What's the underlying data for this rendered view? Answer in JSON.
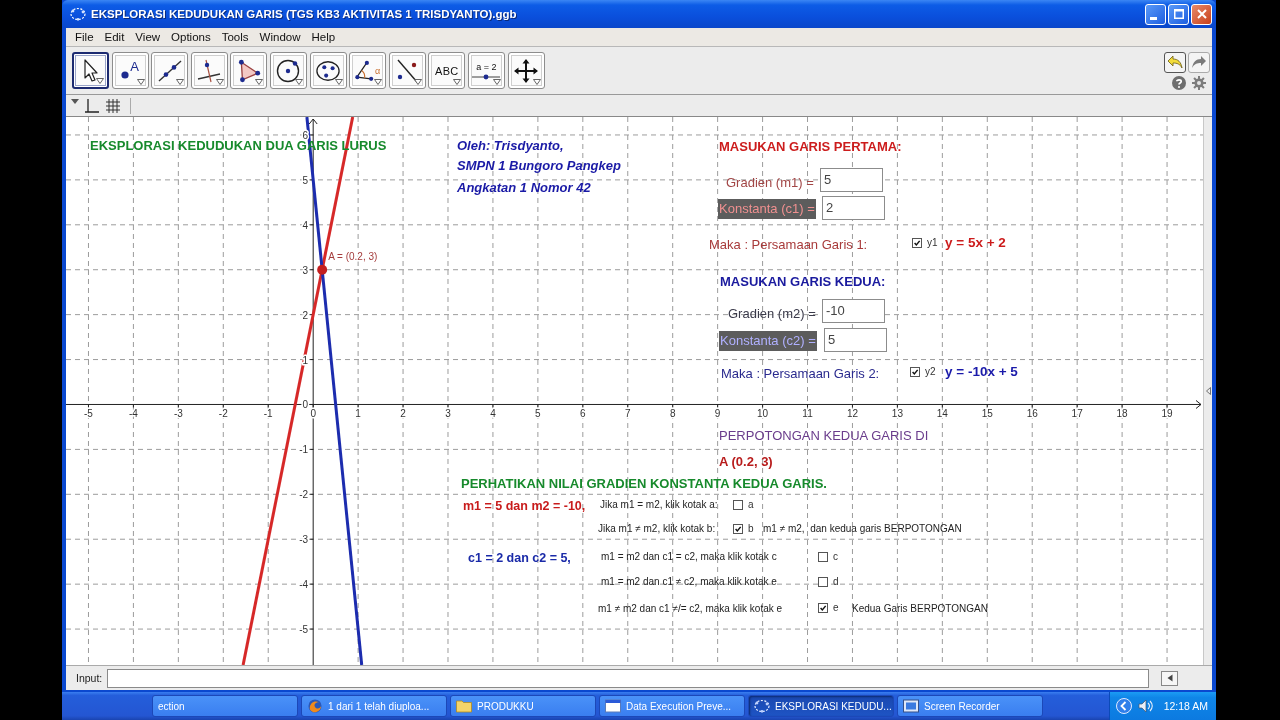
{
  "window": {
    "title": "EKSPLORASI KEDUDUKAN GARIS (TGS KB3 AKTIVITAS 1 TRISDYANTO).ggb"
  },
  "menu": [
    "File",
    "Edit",
    "View",
    "Options",
    "Tools",
    "Window",
    "Help"
  ],
  "toolbar": {
    "tools": [
      {
        "kind": "move",
        "selected": true
      },
      {
        "kind": "point",
        "label": "A",
        "selected": false
      },
      {
        "kind": "line",
        "selected": false
      },
      {
        "kind": "perpendicular",
        "selected": false
      },
      {
        "kind": "polygon",
        "selected": false
      },
      {
        "kind": "circle",
        "selected": false
      },
      {
        "kind": "conic",
        "selected": false
      },
      {
        "kind": "angle",
        "label": "α",
        "selected": false
      },
      {
        "kind": "reflect",
        "selected": false
      },
      {
        "kind": "text",
        "label": "ABC",
        "selected": false
      },
      {
        "kind": "slider",
        "label": "a = 2",
        "selected": false
      },
      {
        "kind": "pan",
        "selected": false
      }
    ]
  },
  "graphics": {
    "chart_data": [
      {
        "type": "line",
        "xlim": [
          -5.5,
          19.8
        ],
        "ylim": [
          -5.8,
          6.4
        ],
        "xticks": [
          -5,
          -4,
          -3,
          -2,
          -1,
          0,
          1,
          2,
          3,
          4,
          5,
          6,
          7,
          8,
          9,
          10,
          11,
          12,
          13,
          14,
          15,
          16,
          17,
          18,
          19
        ],
        "yticks": [
          -5,
          -4,
          -3,
          -2,
          -1,
          0,
          1,
          2,
          3,
          4,
          5,
          6
        ],
        "grid": true,
        "series": [
          {
            "color": "#d62828",
            "x": [
              -1.56,
              0.88
            ],
            "values": [
              -5.8,
              6.4
            ]
          },
          {
            "color": "#1c2cae",
            "x": [
              -0.14,
              1.08
            ],
            "values": [
              6.4,
              -5.8
            ]
          },
          {
            "type": "scatter",
            "color": "#c41e1e",
            "x": [
              0.2
            ],
            "values": [
              3
            ]
          }
        ],
        "annotations": [
          "A = (0.2, 3)"
        ]
      }
    ],
    "title": "EKSPLORASI KEDUDUKAN DUA GARIS LURUS",
    "author_lines": [
      "Oleh: Trisdyanto,",
      "SMPN 1 Bungoro Pangkep",
      "Angkatan 1 Nomor 42"
    ],
    "line_inputs": [
      {
        "heading": "MASUKAN GARIS PERTAMA:",
        "gradient": {
          "label": "Gradien (m1) =",
          "value": "5"
        },
        "constant": {
          "label": "Konstanta (c1) =",
          "value": "2",
          "highlighted": true
        },
        "result": {
          "label": "Maka : Persamaan Garis 1:",
          "checkbox": "y1",
          "checked": true,
          "equation": "y = 5x + 2"
        }
      },
      {
        "heading": "MASUKAN GARIS KEDUA:",
        "gradient": {
          "label": "Gradien (m2) =",
          "value": "-10"
        },
        "constant": {
          "label": "Konstanta (c2) =",
          "value": "5",
          "highlighted": true
        },
        "result": {
          "label": "Maka : Persamaan Garis 2:",
          "checkbox": "y2",
          "checked": true,
          "equation": "y = -10x + 5"
        }
      }
    ],
    "intersection": {
      "label": "PERPOTONGAN KEDUA GARIS DI",
      "point": "A (0.2, 3)"
    },
    "analysis": {
      "heading": "PERHATIKAN NILAI GRADIEN KONSTANTA KEDUA GARIS.",
      "gradients": "m1 = 5 dan m2 = -10,",
      "constants": "c1 = 2 dan c2 = 5,",
      "options": [
        {
          "question": "Jika m1 = m2, klik kotak a:",
          "box": "a",
          "checked": false
        },
        {
          "question": "Jika m1 ≠ m2, klik kotak b:",
          "box": "b",
          "checked": true,
          "result": "m1 ≠ m2,  dan kedua garis BERPOTONGAN"
        },
        {
          "question": "m1 = m2 dan c1 = c2, maka klik kotak c",
          "box": "c",
          "checked": false
        },
        {
          "question": "m1 = m2 dan c1 ≠ c2, maka klik kotak e",
          "box": "d",
          "checked": false
        },
        {
          "question": "m1 ≠ m2 dan c1 ≠/= c2, maka klik kotak e",
          "box": "e",
          "checked": true,
          "result": "Kedua Garis BERPOTONGAN"
        }
      ]
    }
  },
  "input_bar": {
    "label": "Input:"
  },
  "taskbar": {
    "items": [
      {
        "label": "ection",
        "kind": "none",
        "selected": false
      },
      {
        "label": "1 dari 1 telah diuploa...",
        "kind": "browser",
        "selected": false
      },
      {
        "label": "PRODUKKU",
        "kind": "folder",
        "selected": false
      },
      {
        "label": "Data Execution Preve...",
        "kind": "window",
        "selected": false
      },
      {
        "label": "EKSPLORASI KEDUDU...",
        "kind": "geogebra",
        "selected": true
      },
      {
        "label": "Screen Recorder",
        "kind": "recorder",
        "selected": false
      }
    ],
    "clock": "12:18 AM"
  }
}
